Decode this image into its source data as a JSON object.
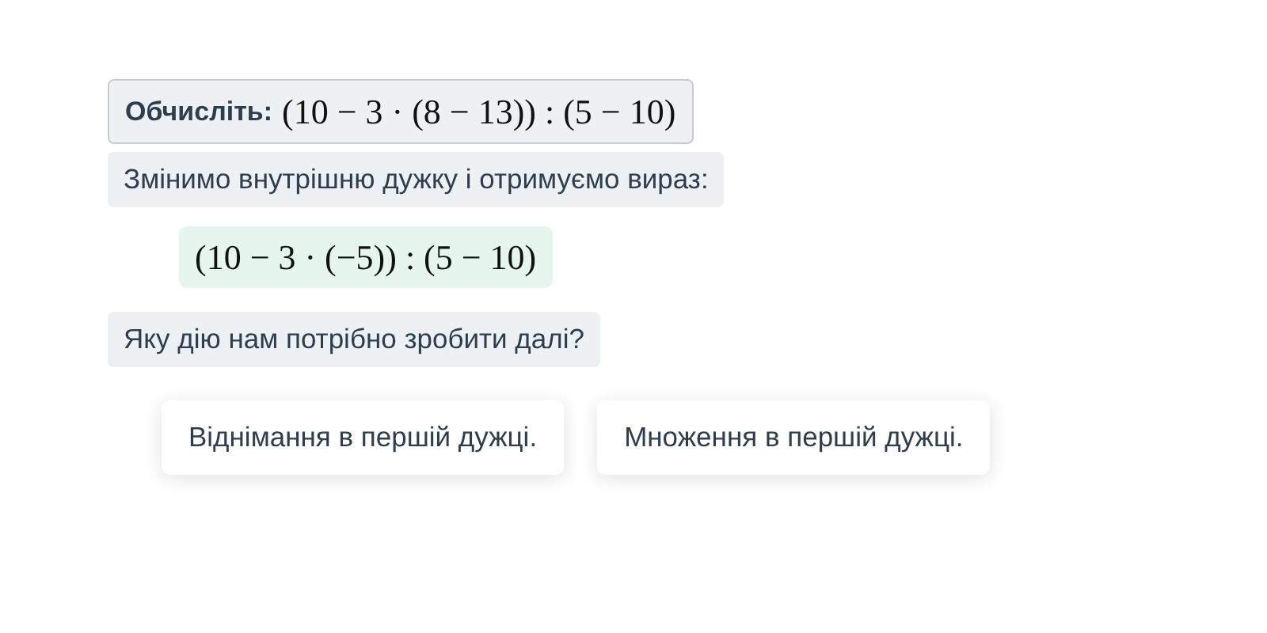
{
  "task": {
    "label": "Обчисліть:",
    "expression": "(10 − 3 · (8 − 13)) : (5 − 10)"
  },
  "messages": [
    {
      "kind": "text",
      "text": "Змінимо внутрішню дужку і отримуємо вираз:"
    },
    {
      "kind": "math",
      "text": "(10 − 3 · (−5)) : (5 − 10)"
    },
    {
      "kind": "text",
      "text": "Яку дію нам потрібно зробити далі?"
    }
  ],
  "answers": [
    "Віднімання в першій дужці.",
    "Множення в першій дужці."
  ]
}
